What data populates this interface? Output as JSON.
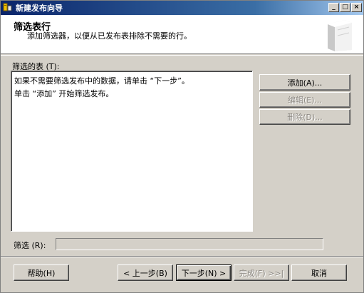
{
  "window": {
    "title": "新建发布向导",
    "buttons": {
      "minimize": "_",
      "maximize": "□",
      "close": "×"
    }
  },
  "header": {
    "title": "筛选表行",
    "subtitle": "添加筛选器，以便从已发布表排除不需要的行。"
  },
  "filtered_tables": {
    "label": "筛选的表 (T):",
    "lines": [
      "如果不需要筛选发布中的数据，请单击 “下一步”。",
      "单击 “添加” 开始筛选发布。"
    ]
  },
  "side_buttons": {
    "add": "添加(A)...",
    "edit": "编辑(E)...",
    "delete": "删除(D)..."
  },
  "filter": {
    "label": "筛选 (R):",
    "value": ""
  },
  "footer": {
    "help": "帮助(H)",
    "back": "< 上一步(B)",
    "next": "下一步(N) >",
    "finish": "完成(F) >>|",
    "cancel": "取消"
  },
  "colors": {
    "titlebar_start": "#0a246a",
    "titlebar_end": "#a6caf0",
    "dialog_bg": "#d4d0c8"
  },
  "icons": [
    "app-icon",
    "wizard-banner-icon"
  ]
}
